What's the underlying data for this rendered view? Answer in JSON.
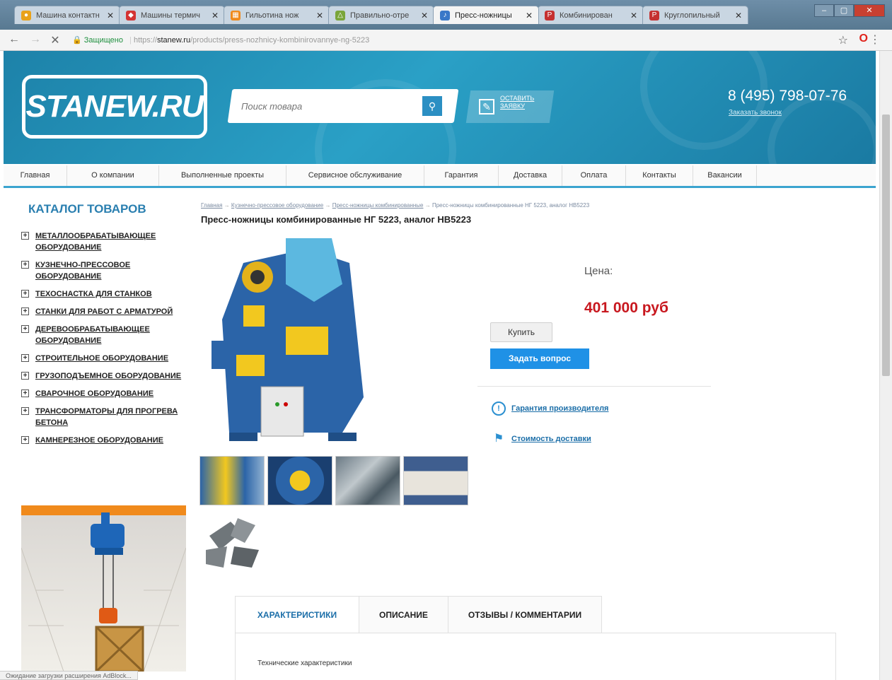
{
  "browser": {
    "tabs": [
      {
        "title": "Машина контактн",
        "fav_color": "#e9a21a",
        "fav": "●"
      },
      {
        "title": "Машины термич",
        "fav_color": "#d43333",
        "fav": "◆"
      },
      {
        "title": "Гильотина нож",
        "fav_color": "#f08a1c",
        "fav": "▦"
      },
      {
        "title": "Правильно-отре",
        "fav_color": "#7aa53a",
        "fav": "△"
      },
      {
        "title": "Пресс-ножницы",
        "fav_color": "#3a78c8",
        "fav": "♪"
      },
      {
        "title": "Комбинирован",
        "fav_color": "#c53030",
        "fav": "P"
      },
      {
        "title": "Круглопильный",
        "fav_color": "#c53030",
        "fav": "P"
      }
    ],
    "url_secure": "Защищено",
    "url_scheme": "https://",
    "url_host": "stanew.ru",
    "url_path": "/products/press-nozhnicy-kombinirovannye-ng-5223",
    "status_text": "Ожидание загрузки расширения AdBlock..."
  },
  "header": {
    "logo": "STANEW.RU",
    "search_placeholder": "Поиск товара",
    "request_label": "Оставить заявку",
    "phone": "8 (495) 798-07-76",
    "callback": "Заказать звонок"
  },
  "nav": [
    {
      "label": "Главная",
      "w": 90
    },
    {
      "label": "О компании",
      "w": 130
    },
    {
      "label": "Выполненные проекты",
      "w": 180
    },
    {
      "label": "Сервисное обслуживание",
      "w": 195
    },
    {
      "label": "Гарантия",
      "w": 105
    },
    {
      "label": "Доставка",
      "w": 90
    },
    {
      "label": "Оплата",
      "w": 90
    },
    {
      "label": "Контакты",
      "w": 95
    },
    {
      "label": "Вакансии",
      "w": 90
    }
  ],
  "sidebar": {
    "title": "КАТАЛОГ ТОВАРОВ",
    "items": [
      "Металлообрабатывающее оборудование",
      "Кузнечно-прессовое оборудование",
      "Техоснастка для станков",
      "Станки для работ с арматурой",
      "Деревообрабатывающее оборудование",
      "Строительное оборудование",
      "Грузоподъемное оборудование",
      "Сварочное оборудование",
      "Трансформаторы для прогрева бетона",
      "Камнерезное оборудование"
    ]
  },
  "product": {
    "breadcrumb": [
      "Главная",
      "Кузнечно-прессовое оборудование",
      "Пресс-ножницы комбинированные",
      "Пресс-ножницы комбинированные НГ 5223, аналог НВ5223"
    ],
    "title": "Пресс-ножницы комбинированные НГ 5223, аналог НВ5223",
    "price_label": "Цена:",
    "price": "401 000 руб",
    "buy": "Купить",
    "ask": "Задать вопрос",
    "warranty": "Гарантия производителя",
    "delivery": "Стоимость доставки",
    "tabs": [
      "ХАРАКТЕРИСТИКИ",
      "ОПИСАНИЕ",
      "ОТЗЫВЫ / КОММЕНТАРИИ"
    ],
    "tab_text": "Технические характеристики"
  },
  "colors": {
    "header_blue": "#2aa0c6",
    "price_red": "#c8181f",
    "button_blue": "#1f91e6",
    "link_blue": "#1b6ea8"
  }
}
